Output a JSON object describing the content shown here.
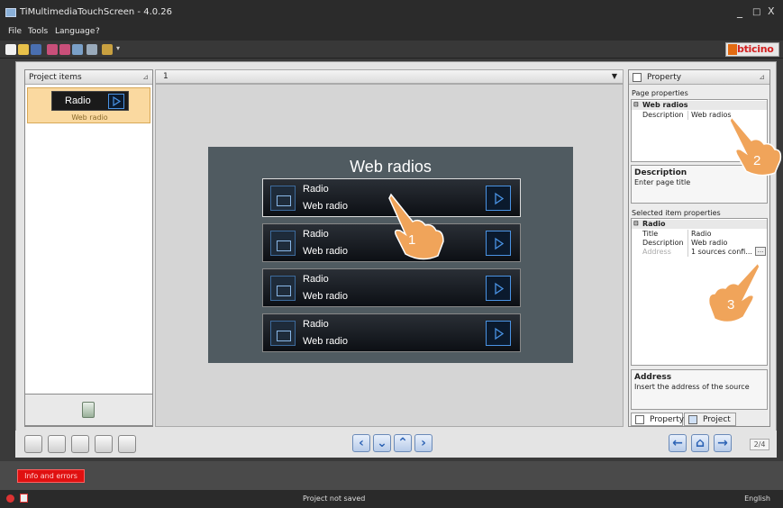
{
  "window": {
    "title": "TiMultimediaTouchScreen - 4.0.26",
    "minimize": "_",
    "maximize": "□",
    "close": "X"
  },
  "menu": {
    "file": "File",
    "tools": "Tools",
    "language": "Language",
    "help": "?"
  },
  "brand": {
    "name": "bticino",
    "color": "#d32020"
  },
  "left_panel": {
    "title": "Project items",
    "item": {
      "title": "Radio",
      "subtitle": "Web radio"
    }
  },
  "center": {
    "page_number": "1",
    "screen_title": "Web radios",
    "rows": [
      {
        "title": "Radio",
        "subtitle": "Web radio"
      },
      {
        "title": "Radio",
        "subtitle": "Web radio"
      },
      {
        "title": "Radio",
        "subtitle": "Web radio"
      },
      {
        "title": "Radio",
        "subtitle": "Web radio"
      }
    ]
  },
  "property_panel": {
    "title": "Property",
    "page_properties_label": "Page properties",
    "page_group": "Web radios",
    "page_rows": [
      {
        "key": "Description",
        "value": "Web radios"
      }
    ],
    "page_desc": {
      "title": "Description",
      "text": "Enter page title"
    },
    "item_properties_label": "Selected item properties",
    "item_group": "Radio",
    "item_rows": [
      {
        "key": "Title",
        "value": "Radio"
      },
      {
        "key": "Description",
        "value": "Web radio"
      },
      {
        "key": "Address",
        "value": "1 sources confi..."
      }
    ],
    "ellipsis": "...",
    "addr_desc": {
      "title": "Address",
      "text": "Insert the address of the source"
    },
    "tabs": {
      "property": "Property",
      "project": "Project"
    }
  },
  "bottom": {
    "page_count": "2/4"
  },
  "info_button": "Info and errors",
  "status": {
    "text": "Project not saved",
    "language": "English"
  },
  "callouts": {
    "c1": "1",
    "c2": "2",
    "c3": "3"
  },
  "colors": {
    "accent_blue": "#4a93e4",
    "selection": "#fad9a0",
    "callout": "#f08a3a"
  }
}
